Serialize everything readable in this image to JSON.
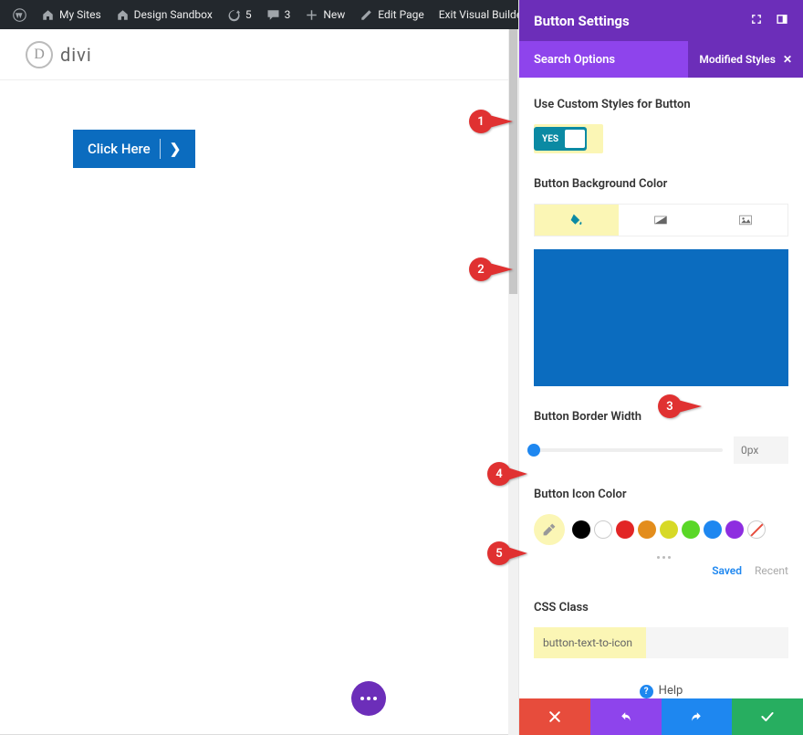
{
  "adminbar": {
    "my_sites": "My Sites",
    "site_name": "Design Sandbox",
    "updates": "5",
    "comments": "3",
    "new": "New",
    "edit_page": "Edit Page",
    "exit_vb": "Exit Visual Builder"
  },
  "logo": {
    "d": "D",
    "text": "divi"
  },
  "demo_button": {
    "label": "Click Here",
    "icon_glyph": "❯"
  },
  "panel": {
    "title": "Button Settings",
    "search_label": "Search Options",
    "chip": {
      "label": "Modified Styles",
      "x": "✕"
    }
  },
  "settings": {
    "custom_styles": {
      "label": "Use Custom Styles for Button",
      "state": "YES"
    },
    "bg_color": {
      "label": "Button Background Color",
      "value": "#0b6cbf"
    },
    "border_width": {
      "label": "Button Border Width",
      "value": "0px"
    },
    "icon_color": {
      "label": "Button Icon Color",
      "saved": "Saved",
      "recent": "Recent",
      "swatches": [
        "#000000",
        "#ffffff",
        "#e22525",
        "#e38d1c",
        "#d7d926",
        "#59d726",
        "#1e87f0",
        "#8e2ee0",
        "none"
      ]
    },
    "css_class": {
      "label": "CSS Class",
      "value": "button-text-to-icon"
    }
  },
  "help": {
    "label": "Help",
    "q": "?"
  },
  "annotations": {
    "n1": "1",
    "n2": "2",
    "n3": "3",
    "n4": "4",
    "n5": "5"
  }
}
